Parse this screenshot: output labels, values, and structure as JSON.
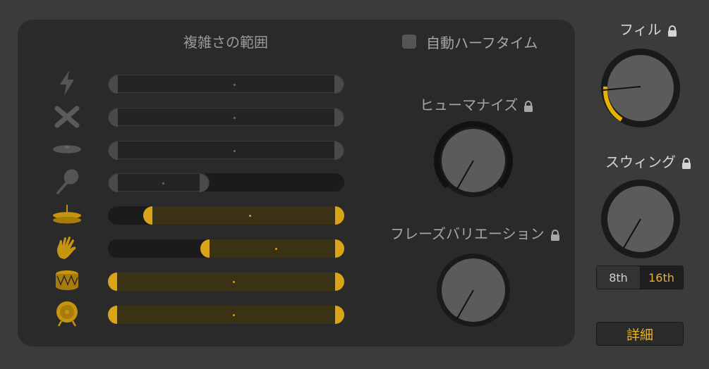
{
  "complexity": {
    "title": "複雑さの範囲",
    "rows": [
      {
        "instrument": "lightning-icon",
        "active": false,
        "range": [
          0.0,
          1.0
        ],
        "dot": 0.53
      },
      {
        "instrument": "drumsticks-icon",
        "active": false,
        "range": [
          0.0,
          1.0
        ],
        "dot": 0.53
      },
      {
        "instrument": "cymbal-icon",
        "active": false,
        "range": [
          0.0,
          1.0
        ],
        "dot": 0.53
      },
      {
        "instrument": "maraca-icon",
        "active": false,
        "range": [
          0.0,
          0.43
        ],
        "dot": 0.23
      },
      {
        "instrument": "hihat-icon",
        "active": true,
        "range": [
          0.15,
          1.0
        ],
        "dot": 0.6
      },
      {
        "instrument": "handclap-icon",
        "active": true,
        "range": [
          0.39,
          1.0
        ],
        "dot": 0.71
      },
      {
        "instrument": "snare-drum-icon",
        "active": true,
        "range": [
          0.0,
          1.0
        ],
        "dot": 0.53
      },
      {
        "instrument": "kick-drum-icon",
        "active": true,
        "range": [
          0.0,
          1.0
        ],
        "dot": 0.53
      }
    ]
  },
  "auto_halftime": {
    "label": "自動ハーフタイム",
    "checked": false
  },
  "knobs": {
    "humanize": {
      "label": "ヒューマナイズ",
      "value": 0.0
    },
    "phrase_variation": {
      "label": "フレーズバリエーション",
      "value": 0.0
    },
    "fill": {
      "label": "フィル",
      "value": 0.22
    },
    "swing": {
      "label": "スウィング",
      "value": 0.0
    }
  },
  "swing_resolution": {
    "options": [
      "8th",
      "16th"
    ],
    "selected": "16th"
  },
  "detail_button": {
    "label": "詳細"
  },
  "colors": {
    "accent": "#e6b22a",
    "gold_handle": "#d9a31a",
    "panel": "#2a2a2a",
    "background": "#3b3b3b"
  }
}
